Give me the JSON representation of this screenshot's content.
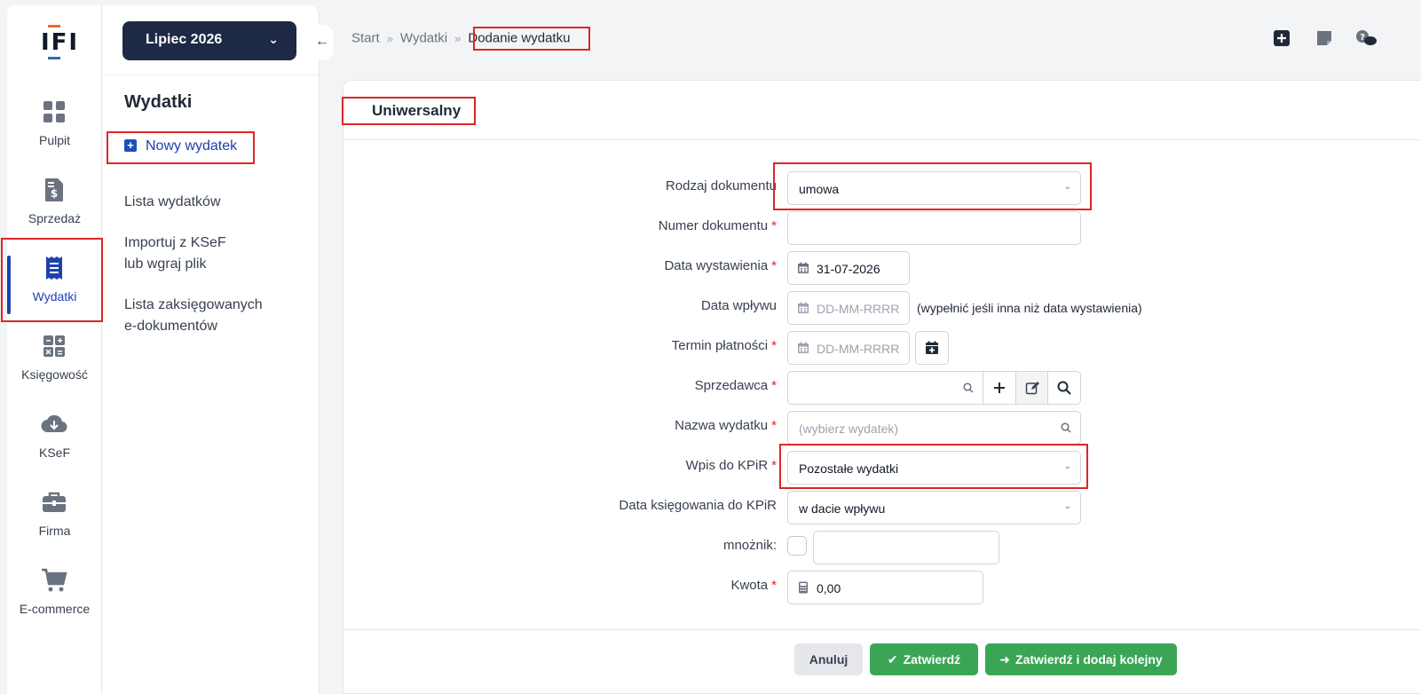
{
  "colors": {
    "accent": "#1e40af",
    "highlight": "#dc2626",
    "success": "#3aa655",
    "dark": "#1e2a45"
  },
  "logo": {
    "text": "IFI"
  },
  "nav": [
    {
      "label": "Pulpit",
      "icon": "grid-icon"
    },
    {
      "label": "Sprzedaż",
      "icon": "invoice-dollar-icon"
    },
    {
      "label": "Wydatki",
      "icon": "receipt-icon",
      "active": true
    },
    {
      "label": "Księgowość",
      "icon": "calculator-icon"
    },
    {
      "label": "KSeF",
      "icon": "cloud-download-icon"
    },
    {
      "label": "Firma",
      "icon": "briefcase-icon"
    },
    {
      "label": "E-commerce",
      "icon": "cart-icon"
    }
  ],
  "sidebar": {
    "month": "Lipiec 2026",
    "title": "Wydatki",
    "new_label": "Nowy wydatek",
    "links": [
      "Lista wydatków",
      "Importuj z KSeF\nlub wgraj plik",
      "Lista zaksięgowanych\ne-dokumentów"
    ]
  },
  "breadcrumb": {
    "items": [
      "Start",
      "Wydatki"
    ],
    "current": "Dodanie wydatku"
  },
  "form": {
    "title": "Uniwersalny",
    "rodzaj": {
      "label": "Rodzaj dokumentu",
      "value": "umowa"
    },
    "numer": {
      "label": "Numer dokumentu",
      "value": ""
    },
    "data_wyst": {
      "label": "Data wystawienia",
      "value": "31-07-2026"
    },
    "data_wplywu": {
      "label": "Data wpływu",
      "placeholder": "DD-MM-RRRR",
      "hint": "(wypełnić jeśli inna niż data wystawienia)"
    },
    "termin": {
      "label": "Termin płatności",
      "placeholder": "DD-MM-RRRR"
    },
    "sprzedawca": {
      "label": "Sprzedawca",
      "value": ""
    },
    "nazwa": {
      "label": "Nazwa wydatku",
      "placeholder": "(wybierz wydatek)"
    },
    "kpir": {
      "label": "Wpis do KPiR",
      "value": "Pozostałe wydatki"
    },
    "data_ksieg": {
      "label": "Data księgowania do KPiR",
      "value": "w dacie wpływu"
    },
    "mnoznik": {
      "label": "mnożnik:",
      "value": ""
    },
    "kwota": {
      "label": "Kwota",
      "value": "0,00"
    }
  },
  "buttons": {
    "cancel": "Anuluj",
    "confirm": "Zatwierdź",
    "confirm_add": "Zatwierdź i dodaj kolejny"
  }
}
